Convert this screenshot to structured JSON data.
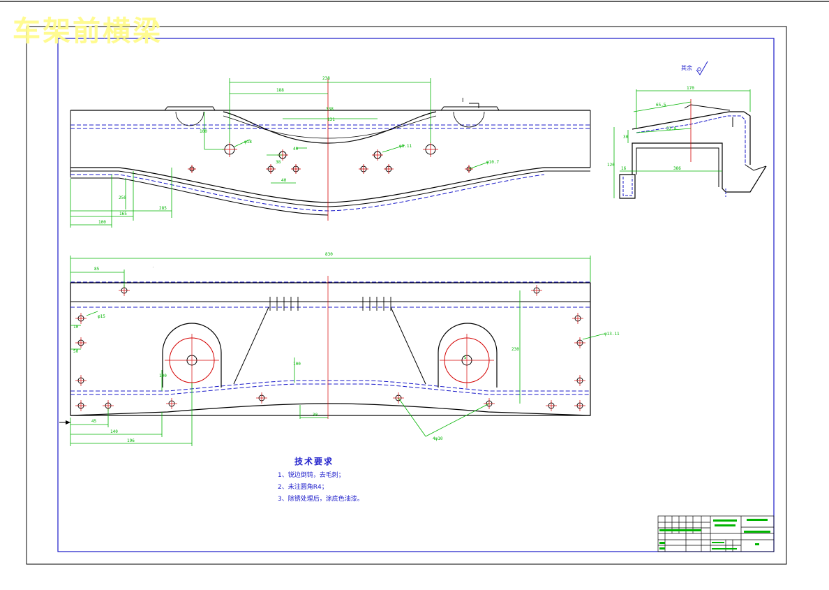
{
  "drawing": {
    "watermark": "车架前横梁",
    "roughness_note": "其余",
    "tech_title": "技术要求",
    "tech_notes": [
      "1、锐边倒钝，去毛刺；",
      "2、未注圆角R4；",
      "3、除锈处理后，涂底色油漆。"
    ],
    "section_label": "I"
  },
  "colors": {
    "outline": "#000000",
    "dimension": "#00b400",
    "centerline": "#d40000",
    "hidden": "#1818c8",
    "watermark": "#fffb8c",
    "notes": "#2222cc"
  }
}
